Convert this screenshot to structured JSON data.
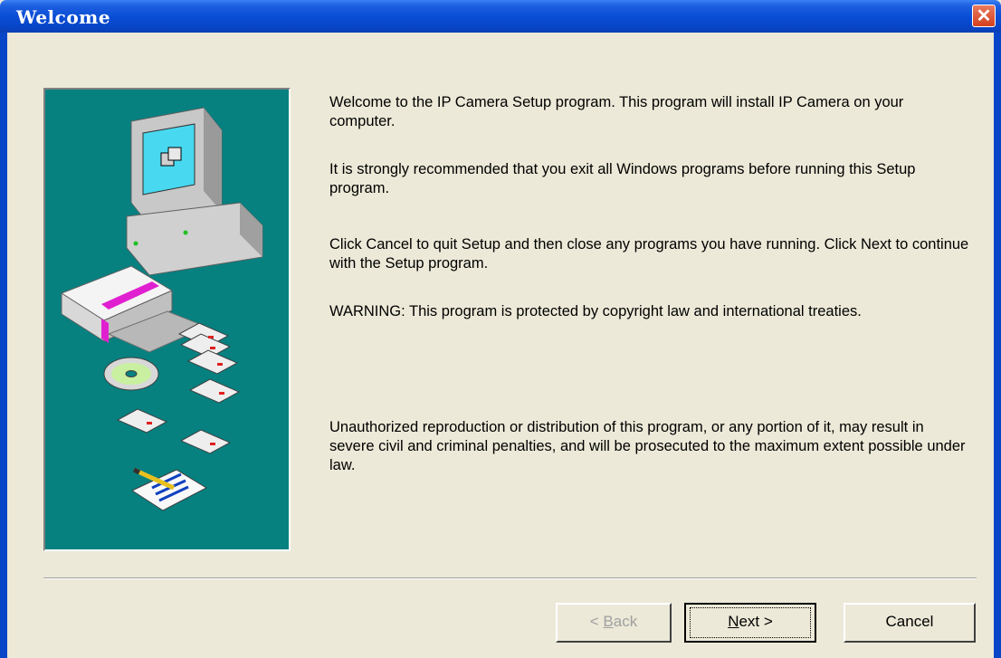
{
  "window": {
    "title": "Welcome",
    "close_glyph": "✕"
  },
  "content": {
    "para1": "Welcome to the IP Camera Setup program. This program will install IP Camera on your computer.",
    "para2": "It is strongly recommended that you exit all Windows programs before running this Setup program.",
    "para3": "Click Cancel to quit Setup and then close any programs you have running. Click Next to continue with the Setup program.",
    "para4": "WARNING: This program is protected by copyright law and international treaties.",
    "para5": "Unauthorized reproduction or distribution of this program, or any portion of it, may result in severe civil and criminal penalties, and will be prosecuted to the maximum extent possible under law."
  },
  "buttons": {
    "back_prefix": "< ",
    "back_mnemonic": "B",
    "back_rest": "ack",
    "next_mnemonic": "N",
    "next_rest": "ext >",
    "cancel": "Cancel"
  },
  "colors": {
    "panel": "#078080",
    "titlebar": "#0a4ed6",
    "close": "#d4401e"
  },
  "icons": [
    "computer-illustration",
    "software-box-illustration",
    "floppy-disk-illustration",
    "cd-illustration",
    "pencil-paper-illustration",
    "close-icon"
  ]
}
